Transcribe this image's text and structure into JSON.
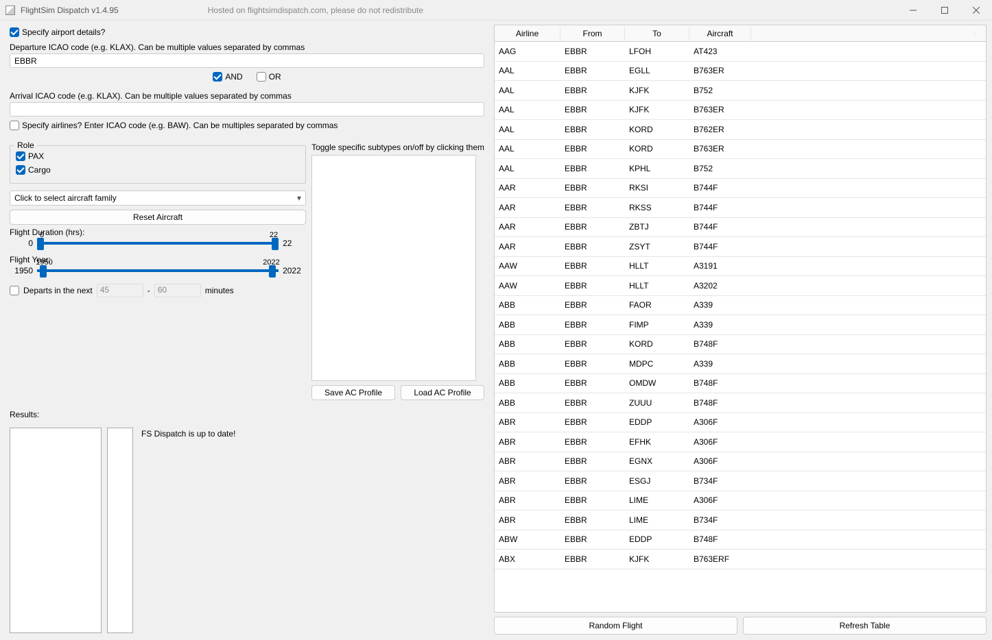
{
  "titlebar": {
    "title": "FlightSim Dispatch v1.4.95",
    "subtitle": "Hosted on flightsimdispatch.com, please do not redistribute"
  },
  "left": {
    "specify_airport_label": "Specify airport details?",
    "dep_label": "Departure ICAO code (e.g. KLAX). Can be multiple values separated by commas",
    "dep_value": "EBBR",
    "and_label": "AND",
    "or_label": "OR",
    "arr_label": "Arrival ICAO code (e.g. KLAX). Can be multiple values separated by commas",
    "arr_value": "",
    "specify_airlines_label": "Specify airlines? Enter ICAO code (e.g. BAW). Can be multiples separated by commas",
    "role_legend": "Role",
    "pax_label": "PAX",
    "cargo_label": "Cargo",
    "toggle_sub_label": "Toggle specific subtypes on/off by clicking them",
    "aircraft_select_placeholder": "Click to select aircraft family",
    "reset_aircraft": "Reset Aircraft",
    "duration_label": "Flight Duration (hrs):",
    "duration_min": "0",
    "duration_max": "22",
    "year_label": "Flight Year:",
    "year_min": "1950",
    "year_max": "2022",
    "departs_label": "Departs in the next",
    "departs_val1": "45",
    "departs_dash": "-",
    "departs_val2": "60",
    "departs_minutes": "minutes",
    "save_profile": "Save AC Profile",
    "load_profile": "Load AC Profile",
    "results_label": "Results:",
    "status_text": "FS Dispatch is up to date!"
  },
  "table": {
    "headers": {
      "airline": "Airline",
      "from": "From",
      "to": "To",
      "aircraft": "Aircraft"
    },
    "rows": [
      {
        "airline": "AAG",
        "from": "EBBR",
        "to": "LFOH",
        "ac": "AT423"
      },
      {
        "airline": "AAL",
        "from": "EBBR",
        "to": "EGLL",
        "ac": "B763ER"
      },
      {
        "airline": "AAL",
        "from": "EBBR",
        "to": "KJFK",
        "ac": "B752"
      },
      {
        "airline": "AAL",
        "from": "EBBR",
        "to": "KJFK",
        "ac": "B763ER"
      },
      {
        "airline": "AAL",
        "from": "EBBR",
        "to": "KORD",
        "ac": "B762ER"
      },
      {
        "airline": "AAL",
        "from": "EBBR",
        "to": "KORD",
        "ac": "B763ER"
      },
      {
        "airline": "AAL",
        "from": "EBBR",
        "to": "KPHL",
        "ac": "B752"
      },
      {
        "airline": "AAR",
        "from": "EBBR",
        "to": "RKSI",
        "ac": "B744F"
      },
      {
        "airline": "AAR",
        "from": "EBBR",
        "to": "RKSS",
        "ac": "B744F"
      },
      {
        "airline": "AAR",
        "from": "EBBR",
        "to": "ZBTJ",
        "ac": "B744F"
      },
      {
        "airline": "AAR",
        "from": "EBBR",
        "to": "ZSYT",
        "ac": "B744F"
      },
      {
        "airline": "AAW",
        "from": "EBBR",
        "to": "HLLT",
        "ac": "A3191"
      },
      {
        "airline": "AAW",
        "from": "EBBR",
        "to": "HLLT",
        "ac": "A3202"
      },
      {
        "airline": "ABB",
        "from": "EBBR",
        "to": "FAOR",
        "ac": "A339"
      },
      {
        "airline": "ABB",
        "from": "EBBR",
        "to": "FIMP",
        "ac": "A339"
      },
      {
        "airline": "ABB",
        "from": "EBBR",
        "to": "KORD",
        "ac": "B748F"
      },
      {
        "airline": "ABB",
        "from": "EBBR",
        "to": "MDPC",
        "ac": "A339"
      },
      {
        "airline": "ABB",
        "from": "EBBR",
        "to": "OMDW",
        "ac": "B748F"
      },
      {
        "airline": "ABB",
        "from": "EBBR",
        "to": "ZUUU",
        "ac": "B748F"
      },
      {
        "airline": "ABR",
        "from": "EBBR",
        "to": "EDDP",
        "ac": "A306F"
      },
      {
        "airline": "ABR",
        "from": "EBBR",
        "to": "EFHK",
        "ac": "A306F"
      },
      {
        "airline": "ABR",
        "from": "EBBR",
        "to": "EGNX",
        "ac": "A306F"
      },
      {
        "airline": "ABR",
        "from": "EBBR",
        "to": "ESGJ",
        "ac": "B734F"
      },
      {
        "airline": "ABR",
        "from": "EBBR",
        "to": "LIME",
        "ac": "A306F"
      },
      {
        "airline": "ABR",
        "from": "EBBR",
        "to": "LIME",
        "ac": "B734F"
      },
      {
        "airline": "ABW",
        "from": "EBBR",
        "to": "EDDP",
        "ac": "B748F"
      },
      {
        "airline": "ABX",
        "from": "EBBR",
        "to": "KJFK",
        "ac": "B763ERF"
      }
    ]
  },
  "footer": {
    "random": "Random Flight",
    "refresh": "Refresh Table"
  }
}
